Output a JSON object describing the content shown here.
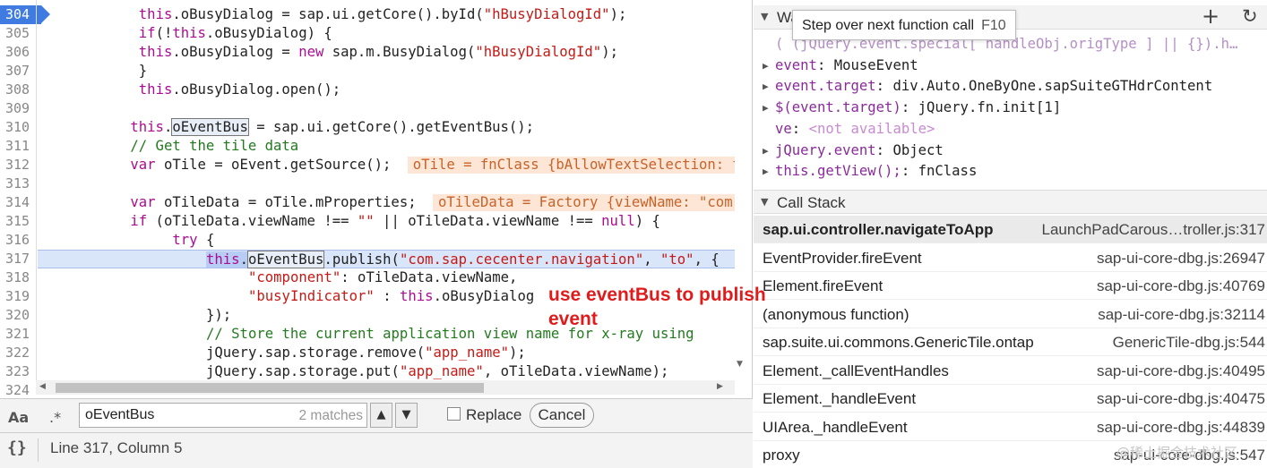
{
  "editor": {
    "lines": [
      {
        "num": "304",
        "breakpoint": true,
        "indent": 12,
        "tokens": [
          [
            "kw",
            "this"
          ],
          [
            "pl",
            ".oBusyDialog = sap.ui.getCore().byId("
          ],
          [
            "str",
            "\"hBusyDialogId\""
          ],
          [
            "pl",
            ");"
          ]
        ]
      },
      {
        "num": "305",
        "indent": 12,
        "tokens": [
          [
            "kw",
            "if"
          ],
          [
            "pl",
            "(!"
          ],
          [
            "kw",
            "this"
          ],
          [
            "pl",
            ".oBusyDialog) {"
          ]
        ]
      },
      {
        "num": "306",
        "indent": 12,
        "tokens": [
          [
            "kw",
            "this"
          ],
          [
            "pl",
            ".oBusyDialog = "
          ],
          [
            "kw",
            "new"
          ],
          [
            "pl",
            " sap.m.BusyDialog("
          ],
          [
            "str",
            "\"hBusyDialogId\""
          ],
          [
            "pl",
            ");"
          ]
        ]
      },
      {
        "num": "307",
        "indent": 12,
        "tokens": [
          [
            "pl",
            "}"
          ]
        ]
      },
      {
        "num": "308",
        "indent": 12,
        "tokens": [
          [
            "kw",
            "this"
          ],
          [
            "pl",
            ".oBusyDialog.open();"
          ]
        ]
      },
      {
        "num": "309",
        "indent": 0,
        "tokens": []
      },
      {
        "num": "310",
        "indent": 11,
        "tokens": [
          [
            "kw",
            "this"
          ],
          [
            "pl",
            "."
          ],
          [
            "hit",
            "oEventBus"
          ],
          [
            "pl",
            " = sap.ui.getCore().getEventBus();"
          ]
        ]
      },
      {
        "num": "311",
        "indent": 11,
        "tokens": [
          [
            "cm",
            "// Get the tile data"
          ]
        ]
      },
      {
        "num": "312",
        "indent": 11,
        "tokens": [
          [
            "kw",
            "var"
          ],
          [
            "pl",
            " oTile = oEvent.getSource();"
          ]
        ],
        "inline": "oTile = fnClass {bAllowTextSelection: tr"
      },
      {
        "num": "313",
        "indent": 0,
        "tokens": []
      },
      {
        "num": "314",
        "indent": 11,
        "tokens": [
          [
            "kw",
            "var"
          ],
          [
            "pl",
            " oTileData = oTile.mProperties;"
          ]
        ],
        "inline": "oTileData = Factory {viewName: \"com"
      },
      {
        "num": "315",
        "indent": 11,
        "tokens": [
          [
            "kw",
            "if"
          ],
          [
            "pl",
            " (oTileData.viewName !== "
          ],
          [
            "str",
            "\"\""
          ],
          [
            "pl",
            " || oTileData.viewName !== "
          ],
          [
            "kw",
            "null"
          ],
          [
            "pl",
            ") {"
          ]
        ]
      },
      {
        "num": "316",
        "indent": 16,
        "tokens": [
          [
            "kw",
            "try"
          ],
          [
            "pl",
            " {"
          ]
        ]
      },
      {
        "num": "317",
        "exec": true,
        "indent": 20,
        "tokens": [
          [
            "selkw",
            "this"
          ],
          [
            "sel",
            "."
          ],
          [
            "selhit",
            "oEventBus"
          ],
          [
            "pl",
            ".publish("
          ],
          [
            "str",
            "\"com.sap.cecenter.navigation\""
          ],
          [
            "pl",
            ", "
          ],
          [
            "str",
            "\"to\""
          ],
          [
            "pl",
            ", {"
          ]
        ]
      },
      {
        "num": "318",
        "indent": 25,
        "tokens": [
          [
            "str",
            "\"component\""
          ],
          [
            "pl",
            ": oTileData.viewName,"
          ]
        ]
      },
      {
        "num": "319",
        "indent": 25,
        "tokens": [
          [
            "str",
            "\"busyIndicator\""
          ],
          [
            "pl",
            " : "
          ],
          [
            "kw",
            "this"
          ],
          [
            "pl",
            ".oBusyDialog"
          ]
        ]
      },
      {
        "num": "320",
        "indent": 20,
        "tokens": [
          [
            "pl",
            "});"
          ]
        ]
      },
      {
        "num": "321",
        "indent": 20,
        "tokens": [
          [
            "cm",
            "// Store the current application view name for x-ray using"
          ]
        ]
      },
      {
        "num": "322",
        "indent": 20,
        "tokens": [
          [
            "pl",
            "jQuery.sap.storage.remove("
          ],
          [
            "str",
            "\"app_name\""
          ],
          [
            "pl",
            ");"
          ]
        ]
      },
      {
        "num": "323",
        "indent": 20,
        "tokens": [
          [
            "pl",
            "jQuery.sap.storage.put("
          ],
          [
            "str",
            "\"app_name\""
          ],
          [
            "pl",
            ", oTileData.viewName);"
          ]
        ]
      },
      {
        "num": "324",
        "indent": 0,
        "tokens": []
      }
    ],
    "annotation": "use eventBus to publish event",
    "scroll_down_glyph": "▼",
    "scroll_left_glyph": "◀",
    "scroll_right_glyph": "▶"
  },
  "search": {
    "case_toggle": "Aa",
    "regex_toggle": ".*",
    "query": "oEventBus",
    "match_count": "2 matches",
    "prev_glyph": "▲",
    "next_glyph": "▼",
    "replace_label": "Replace",
    "cancel_label": "Cancel"
  },
  "status": {
    "pretty_print": "{}",
    "cursor": "Line 317, Column 5"
  },
  "watch": {
    "title": "Wa",
    "add_glyph": "+",
    "refresh_glyph": "↻",
    "tooltip_text": "Step over next function call",
    "tooltip_shortcut": "F10",
    "rows": [
      {
        "expandable": false,
        "faded": true,
        "expr": "( (jQuery.event.special[ handleObj.origType ] || {}).h…",
        "value": ""
      },
      {
        "expandable": true,
        "expr": "event",
        "value": "MouseEvent"
      },
      {
        "expandable": true,
        "expr": "event.target",
        "value": "div.Auto.OneByOne.sapSuiteGTHdrContent"
      },
      {
        "expandable": true,
        "expr": "$(event.target)",
        "value": "jQuery.fn.init[1]"
      },
      {
        "expandable": false,
        "expr": "ve",
        "value": "<not available>",
        "na": true
      },
      {
        "expandable": true,
        "expr": "jQuery.event",
        "value": "Object"
      },
      {
        "expandable": true,
        "expr": "this.getView();",
        "value": "fnClass"
      }
    ]
  },
  "callstack": {
    "title": "Call Stack",
    "frames": [
      {
        "fn": "sap.ui.controller.navigateToApp",
        "loc": "LaunchPadCarous…troller.js:317",
        "active": true
      },
      {
        "fn": "EventProvider.fireEvent",
        "loc": "sap-ui-core-dbg.js:26947"
      },
      {
        "fn": "Element.fireEvent",
        "loc": "sap-ui-core-dbg.js:40769"
      },
      {
        "fn": "(anonymous function)",
        "loc": "sap-ui-core-dbg.js:32114"
      },
      {
        "fn": "sap.suite.ui.commons.GenericTile.ontap",
        "loc": "GenericTile-dbg.js:544"
      },
      {
        "fn": "Element._callEventHandles",
        "loc": "sap-ui-core-dbg.js:40495"
      },
      {
        "fn": "Element._handleEvent",
        "loc": "sap-ui-core-dbg.js:40475"
      },
      {
        "fn": "UIArea._handleEvent",
        "loc": "sap-ui-core-dbg.js:44839"
      },
      {
        "fn": "proxy",
        "loc": "sap-ui-core-dbg.js:547"
      }
    ]
  },
  "watermark": "@稀土掘金技术社区"
}
